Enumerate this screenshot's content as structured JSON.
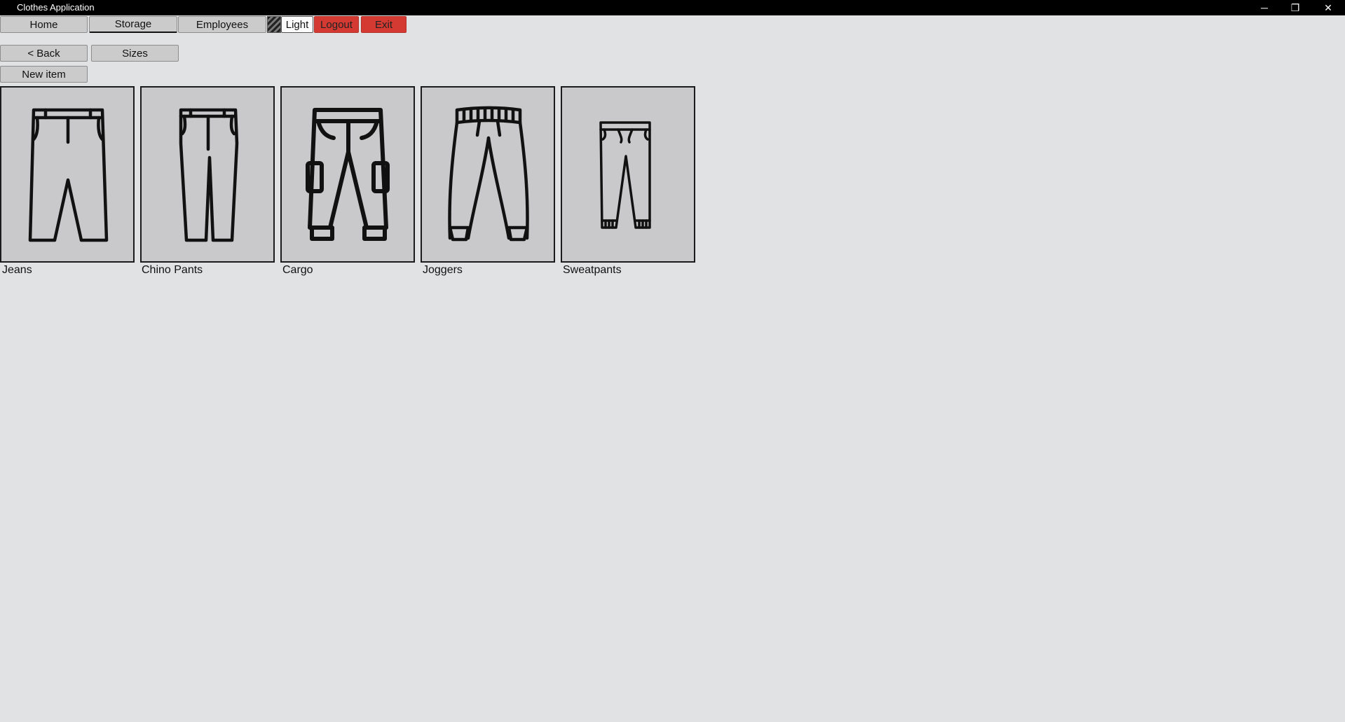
{
  "window": {
    "title": "Clothes Application",
    "minimize_glyph": "─",
    "maximize_glyph": "❐",
    "close_glyph": "✕"
  },
  "nav": {
    "home": "Home",
    "storage": "Storage",
    "employees": "Employees",
    "theme_label": "Light",
    "logout": "Logout",
    "exit": "Exit"
  },
  "actions": {
    "back": "< Back",
    "sizes": "Sizes",
    "new_item": "New item"
  },
  "items": [
    {
      "name": "Jeans",
      "icon": "jeans-icon"
    },
    {
      "name": "Chino Pants",
      "icon": "chino-pants-icon"
    },
    {
      "name": "Cargo",
      "icon": "cargo-pants-icon"
    },
    {
      "name": "Joggers",
      "icon": "joggers-icon"
    },
    {
      "name": "Sweatpants",
      "icon": "sweatpants-icon"
    }
  ],
  "colors": {
    "background": "#e1e2e4",
    "titlebar": "#000000",
    "button": "#cbcbcc",
    "danger": "#d43a32",
    "card": "#c9c9cb"
  }
}
